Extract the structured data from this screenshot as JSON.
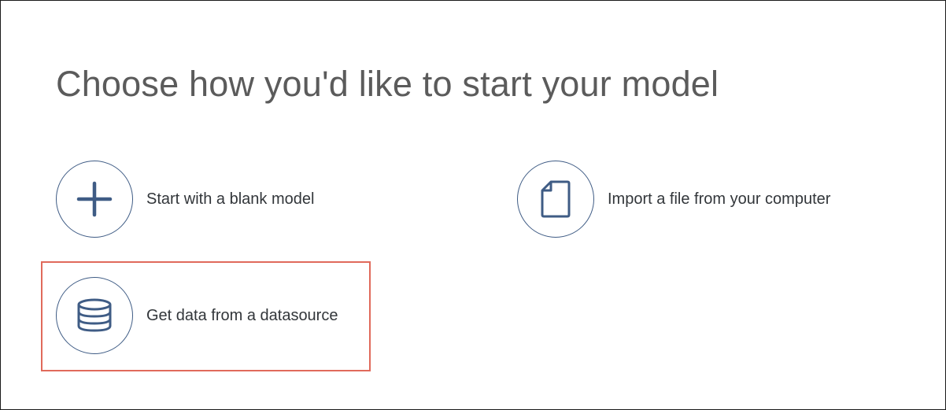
{
  "page": {
    "title": "Choose how you'd like to start your model"
  },
  "options": [
    {
      "label": "Start with a blank model",
      "icon": "plus-icon"
    },
    {
      "label": "Import a file from your computer",
      "icon": "document-icon"
    },
    {
      "label": "Get data from a datasource",
      "icon": "database-icon",
      "highlighted": true
    }
  ],
  "colors": {
    "title": "#5b5b5b",
    "icon_accent": "#3f5c85",
    "highlight": "#e06a5b",
    "label": "#32363a"
  }
}
